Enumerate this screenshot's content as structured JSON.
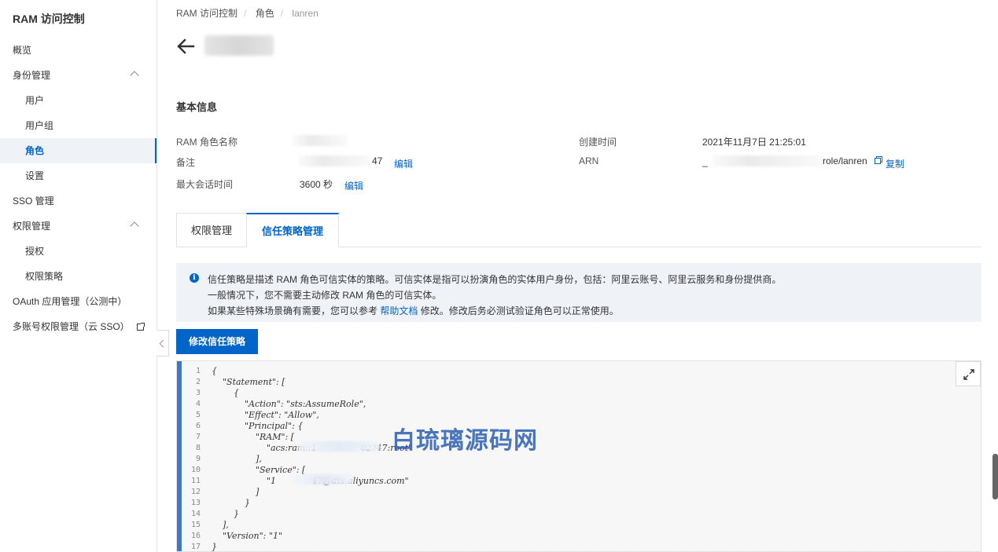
{
  "sidebar": {
    "title": "RAM 访问控制",
    "items": [
      {
        "label": "概览"
      },
      {
        "label": "身份管理"
      },
      {
        "label": "用户"
      },
      {
        "label": "用户组"
      },
      {
        "label": "角色"
      },
      {
        "label": "设置"
      },
      {
        "label": "SSO 管理"
      },
      {
        "label": "权限管理"
      },
      {
        "label": "授权"
      },
      {
        "label": "权限策略"
      },
      {
        "label": "OAuth 应用管理（公测中）"
      },
      {
        "label": "多账号权限管理（云 SSO）"
      }
    ]
  },
  "breadcrumb": [
    "RAM 访问控制",
    "角色",
    "lanren"
  ],
  "basic_info": {
    "title": "基本信息",
    "role_name_label": "RAM 角色名称",
    "remark_label": "备注",
    "remark_value_suffix": "47",
    "max_session_label": "最大会话时间",
    "max_session_value": "3600 秒",
    "edit_label": "编辑",
    "created_label": "创建时间",
    "created_value": "2021年11月7日 21:25:01",
    "arn_label": "ARN",
    "arn_prefix": "_",
    "arn_suffix": "role/lanren",
    "copy_label": "复制"
  },
  "tabs": [
    {
      "label": "权限管理"
    },
    {
      "label": "信任策略管理"
    }
  ],
  "notice": {
    "line1": "信任策略是描述 RAM 角色可信实体的策略。可信实体是指可以扮演角色的实体用户身份，包括：阿里云账号、阿里云服务和身份提供商。",
    "line2": "一般情况下，您不需要主动修改 RAM 角色的可信实体。",
    "line3_before": "如果某些特殊场景确有需要，您可以参考 ",
    "line3_link": "帮助文档",
    "line3_after": " 修改。修改后务必测试验证角色可以正常使用。"
  },
  "edit_policy_button": "修改信任策略",
  "editor": {
    "line_numbers": [
      "1",
      "2",
      "3",
      "4",
      "5",
      "6",
      "7",
      "8",
      "9",
      "10",
      "11",
      "12",
      "13",
      "14",
      "15",
      "16",
      "17"
    ],
    "lines": [
      {
        "t": "{"
      },
      {
        "t": "    \"Statement\": ["
      },
      {
        "t": "        {"
      },
      {
        "t": "            \"Action\": \"sts:AssumeRole\","
      },
      {
        "t": "            \"Effect\": \"Allow\","
      },
      {
        "t": "            \"Principal\": {"
      },
      {
        "t": "                \"RAM\": ["
      },
      {
        "t": "                    \"acs:ram::1                02?47:root\""
      },
      {
        "t": "                ],"
      },
      {
        "t": "                \"Service\": ["
      },
      {
        "t": "                    \"1             47@dts.aliyuncs.com\""
      },
      {
        "t": "                ]"
      },
      {
        "t": "            }"
      },
      {
        "t": "        }"
      },
      {
        "t": "    ],"
      },
      {
        "t": "    \"Version\": \"1\""
      },
      {
        "t": "}"
      }
    ]
  },
  "watermark": "白琉璃源码网"
}
